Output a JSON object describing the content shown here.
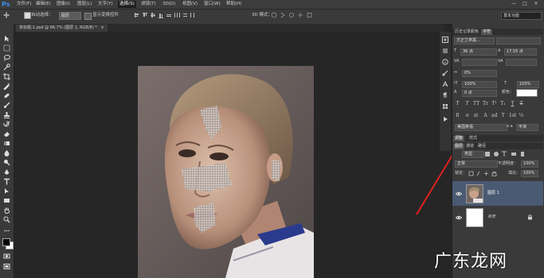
{
  "app": {
    "logo": "Ps"
  },
  "menu": {
    "items": [
      "文件(F)",
      "编辑(E)",
      "图像(I)",
      "图层(L)",
      "文字(Y)",
      "选择(S)",
      "滤镜(T)",
      "3D(D)",
      "视图(V)",
      "窗口(W)",
      "帮助(H)"
    ],
    "active_index": 5
  },
  "window_controls": [
    "—",
    "□",
    "✕"
  ],
  "options": {
    "auto_select_label": "自动选择：",
    "auto_select_value": "图层",
    "show_transform_label": "显示变换控件",
    "mode_3d_label": "3D 模式：",
    "workspace": "基本功能"
  },
  "document": {
    "tab_title": "未标题-1.psd @ 66.7% (图层 1, RGB/8) *",
    "close": "×"
  },
  "character_panel": {
    "tabs": [
      "历史记录",
      "颜色",
      "字符"
    ],
    "active_tab": 2,
    "font_family": "方正兰亭黑...",
    "font_size": "36 点",
    "leading": "17.55 点",
    "tracking": "0%",
    "vertical_scale": "100%",
    "horizontal_scale": "100%",
    "baseline_shift": "0 点",
    "color_label": "颜色：",
    "style_buttons": [
      "T",
      "T",
      "TT",
      "Tr",
      "T¹",
      "T₁",
      "T",
      "T"
    ],
    "extra_buttons": [
      "fi",
      "ơ",
      "st",
      "A",
      "ad",
      "T",
      "1st",
      "½"
    ],
    "language": "美国英语",
    "antialias": "平滑",
    "antialias_prefix": "a a"
  },
  "layers_panel": {
    "tabs": [
      "图层",
      "通道",
      "路径"
    ],
    "sub_tabs": [
      "调整",
      "样式"
    ],
    "filter_label": "类型",
    "blend_mode": "正常",
    "opacity_label": "不透明度：",
    "opacity": "100%",
    "lock_label": "锁定：",
    "fill_label": "填充：",
    "fill": "100%",
    "layers": [
      {
        "name": "图层 1",
        "selected": true
      },
      {
        "name": "背景",
        "selected": false
      }
    ]
  },
  "watermark": "广东龙网",
  "colors": {
    "accent": "#3b8fe8",
    "annotation_arrow": "#e02020",
    "selected_layer": "#4a5a73"
  }
}
